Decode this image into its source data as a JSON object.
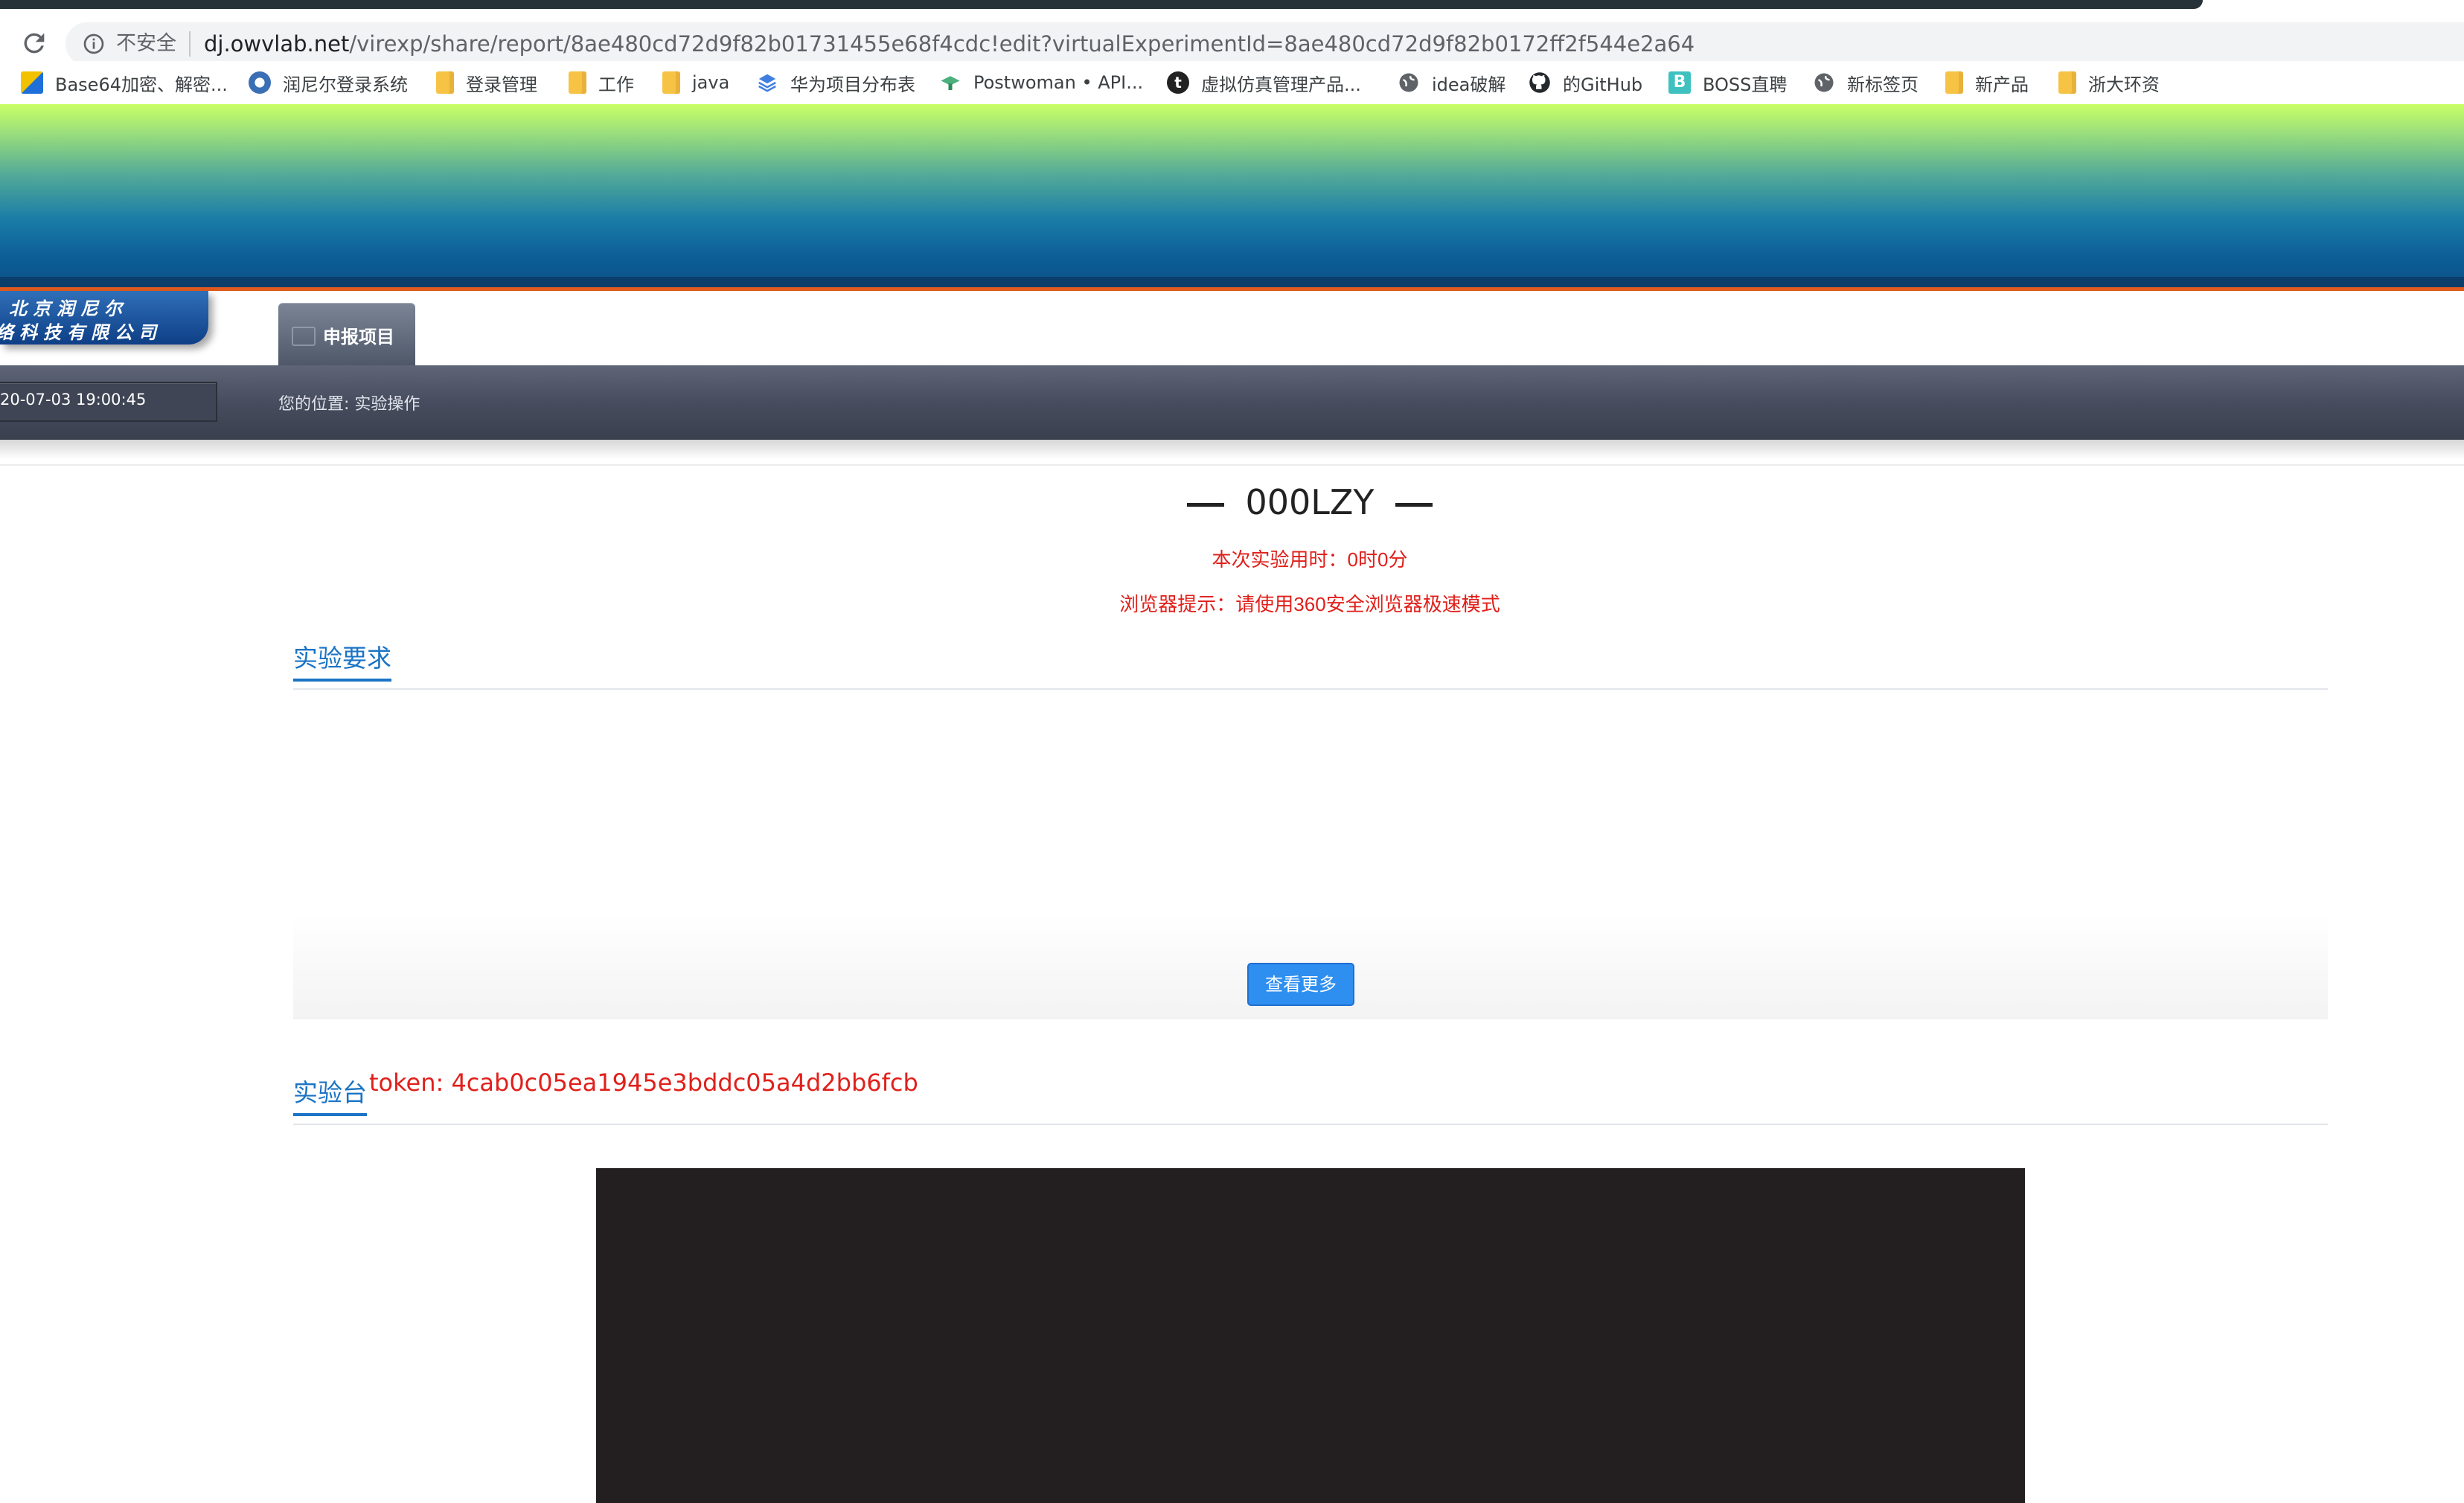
{
  "browser": {
    "security_label": "不安全",
    "url_host": "dj.owvlab.net",
    "url_path": "/virexp/share/report/8ae480cd72d9f82b01731455e68f4cdc!edit?virtualExperimentId=8ae480cd72d9f82b0172ff2f544e2a64"
  },
  "bookmarks": [
    {
      "label": "Base64加密、解密...",
      "icon": "base64-tool-icon"
    },
    {
      "label": "润尼尔登录系统",
      "icon": "globe-logo-icon"
    },
    {
      "label": "登录管理",
      "icon": "folder-icon"
    },
    {
      "label": "工作",
      "icon": "folder-icon"
    },
    {
      "label": "java",
      "icon": "folder-icon"
    },
    {
      "label": "华为项目分布表",
      "icon": "layers-icon"
    },
    {
      "label": "Postwoman • API...",
      "icon": "postwoman-icon"
    },
    {
      "label": "虚拟仿真管理产品...",
      "icon": "t-logo-icon"
    },
    {
      "label": "idea破解",
      "icon": "globe-icon"
    },
    {
      "label": "的GitHub",
      "icon": "github-icon"
    },
    {
      "label": "BOSS直聘",
      "icon": "boss-icon"
    },
    {
      "label": "新标签页",
      "icon": "globe-icon"
    },
    {
      "label": "新产品",
      "icon": "folder-icon"
    },
    {
      "label": "浙大环资",
      "icon": "folder-icon"
    }
  ],
  "site": {
    "logo_line1": "北京润尼尔",
    "logo_line2": "络科技有限公司",
    "nav_tab": "申报项目",
    "datetime": "20-07-03 19:00:45",
    "breadcrumb": "您的位置: 实验操作"
  },
  "report": {
    "title": "000LZY",
    "time_prefix": "本次实验用时：",
    "time_hours": "0",
    "time_hours_unit": "时",
    "time_minutes": "0",
    "time_minutes_unit": "分",
    "hint_prefix": "浏览器提示：请使用",
    "hint_number": "360",
    "hint_suffix": "安全浏览器极速模式"
  },
  "sections": {
    "requirements_title": "实验要求",
    "more_button": "查看更多",
    "workbench_title": "实验台",
    "token_text": "token: 4cab0c05ea1945e3bddc05a4d2bb6fcb"
  },
  "colors": {
    "accent_blue": "#1b74c5",
    "alert_red": "#e0201b",
    "button_blue": "#2f8ff0",
    "workbench_bg": "#231f20"
  }
}
